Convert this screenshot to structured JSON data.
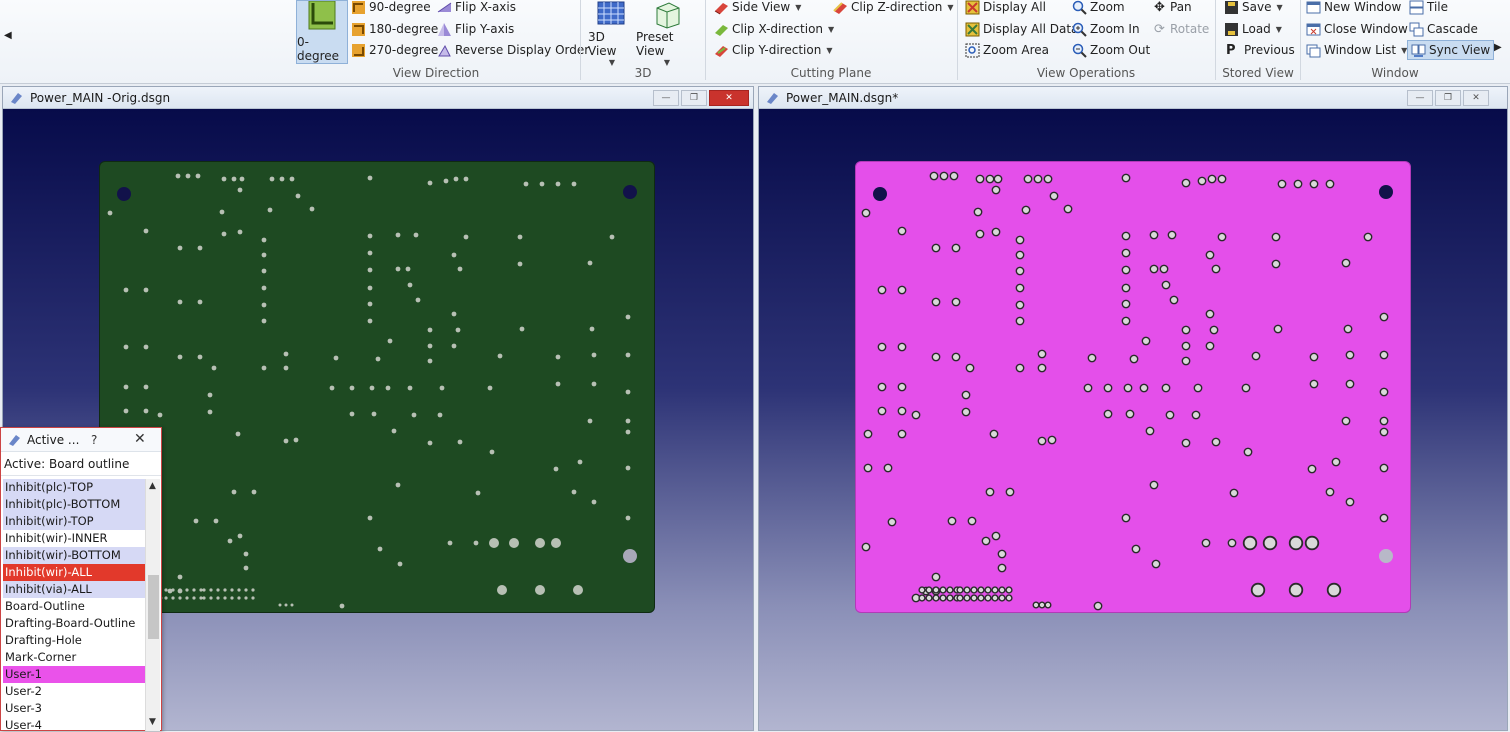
{
  "ribbon": {
    "view_direction": {
      "label": "View Direction",
      "btn_0": "0-degree",
      "btn_90": "90-degree",
      "btn_180": "180-degree",
      "btn_270": "270-degree",
      "flip_x": "Flip X-axis",
      "flip_y": "Flip Y-axis",
      "reverse": "Reverse Display Order"
    },
    "three_d": {
      "label": "3D",
      "view_3d": "3D View",
      "preset": "Preset View"
    },
    "cutting_plane": {
      "label": "Cutting Plane",
      "side_view": "Side View",
      "clip_x": "Clip X-direction",
      "clip_y": "Clip Y-direction",
      "clip_z": "Clip Z-direction"
    },
    "view_operations": {
      "label": "View Operations",
      "display_all": "Display All",
      "display_all_data": "Display All Data",
      "zoom_area": "Zoom Area",
      "zoom": "Zoom",
      "zoom_in": "Zoom In",
      "zoom_out": "Zoom Out",
      "pan": "Pan",
      "rotate": "Rotate"
    },
    "stored_view": {
      "label": "Stored View",
      "save": "Save",
      "load": "Load",
      "previous": "Previous"
    },
    "window": {
      "label": "Window",
      "new_window": "New Window",
      "close_window": "Close Window",
      "window_list": "Window List",
      "tile": "Tile",
      "cascade": "Cascade",
      "sync_view": "Sync View"
    }
  },
  "windows": {
    "left_title": "Power_MAIN -Orig.dsgn",
    "right_title": "Power_MAIN.dsgn*"
  },
  "layer_panel": {
    "title": "Active ...",
    "help": "?",
    "close": "✕",
    "active_label": "Active: Board outline",
    "items": [
      "Inhibit(plc)-TOP",
      "Inhibit(plc)-BOTTOM",
      "Inhibit(wir)-TOP",
      "Inhibit(wir)-INNER",
      "Inhibit(wir)-BOTTOM",
      "Inhibit(wir)-ALL",
      "Inhibit(via)-ALL",
      "Board-Outline",
      "Drafting-Board-Outline",
      "Drafting-Hole",
      "Mark-Corner",
      "User-1",
      "User-2",
      "User-3",
      "User-4"
    ]
  },
  "colors": {
    "board_left": "#1e4a22",
    "board_right": "#e44fea",
    "accent_red": "#e2392b",
    "highlight": "#d6d9f5"
  }
}
